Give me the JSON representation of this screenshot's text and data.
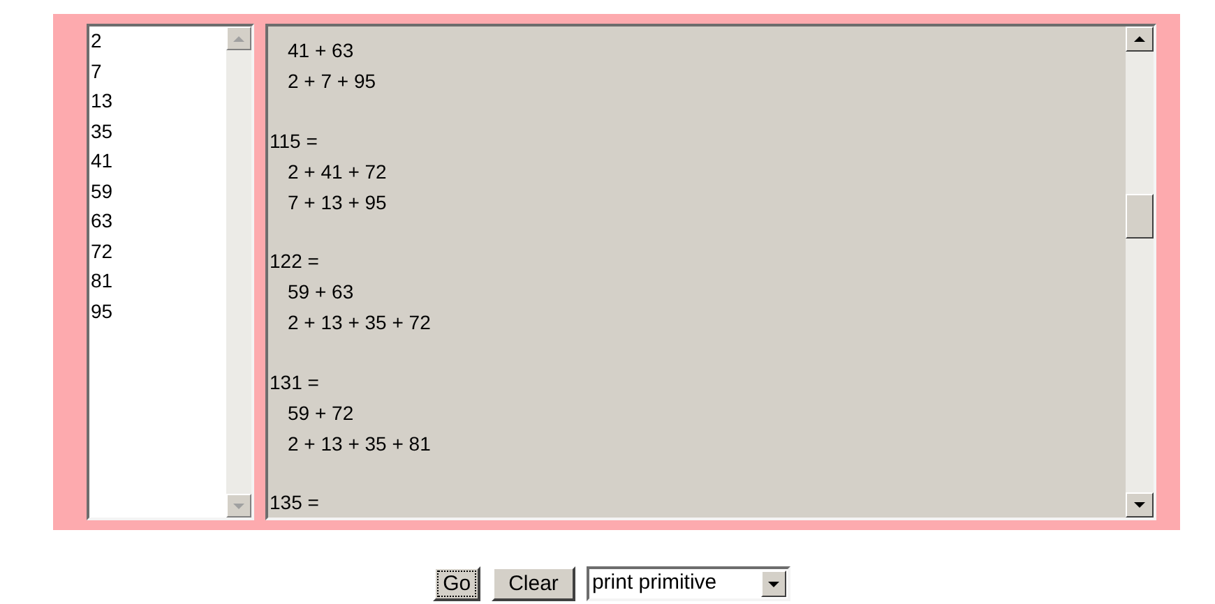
{
  "numbers": [
    "2",
    "7",
    "13",
    "35",
    "41",
    "59",
    "63",
    "72",
    "81",
    "95"
  ],
  "output": {
    "groups": [
      {
        "sums": [
          "41 + 63",
          "2 + 7 + 95"
        ]
      },
      {
        "total": "115 =",
        "sums": [
          "2 + 41 + 72",
          "7 + 13 + 95"
        ]
      },
      {
        "total": "122 =",
        "sums": [
          "59 + 63",
          "2 + 13 + 35 + 72"
        ]
      },
      {
        "total": "131 =",
        "sums": [
          "59 + 72",
          "2 + 13 + 35 + 81"
        ]
      },
      {
        "total": "135 ="
      }
    ]
  },
  "buttons": [
    {
      "label": "Go",
      "focused": true
    },
    {
      "label": "Clear",
      "focused": false
    }
  ],
  "mode_select": {
    "value": "print primitive"
  }
}
